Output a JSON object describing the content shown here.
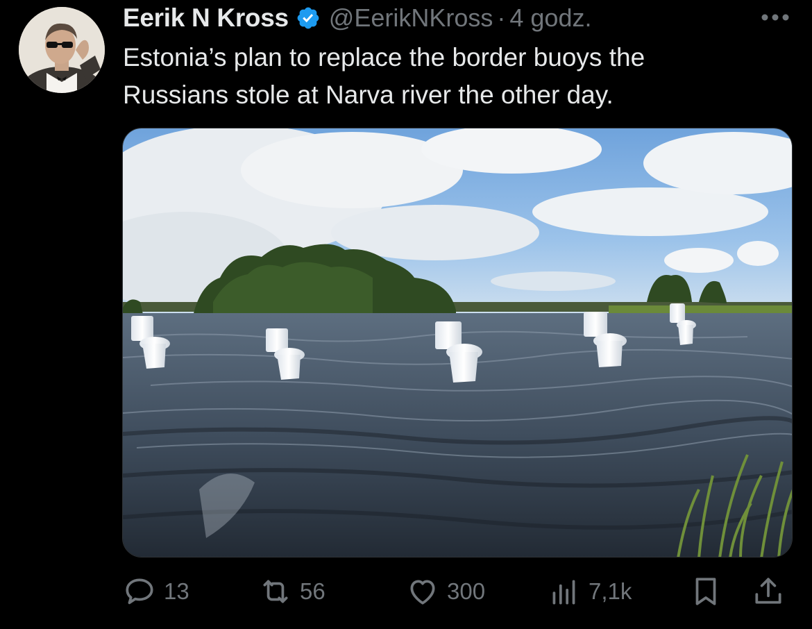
{
  "tweet": {
    "author_name": "Eerik N Kross",
    "verified": true,
    "handle": "@EerikNKross",
    "separator": "·",
    "time": "4 godz.",
    "text_line1": "Estonia’s plan to replace the border buoys the",
    "text_line2": "Russians stole at Narva river the other day."
  },
  "actions": {
    "replies": "13",
    "reposts": "56",
    "likes": "300",
    "views": "7,1k"
  },
  "colors": {
    "background": "#000000",
    "text": "#e7e9ea",
    "secondary": "#71767b",
    "verified": "#1d9bf0"
  },
  "icons": [
    "verified-badge-icon",
    "more-icon",
    "reply-icon",
    "repost-icon",
    "like-icon",
    "views-icon",
    "bookmark-icon",
    "share-icon"
  ]
}
